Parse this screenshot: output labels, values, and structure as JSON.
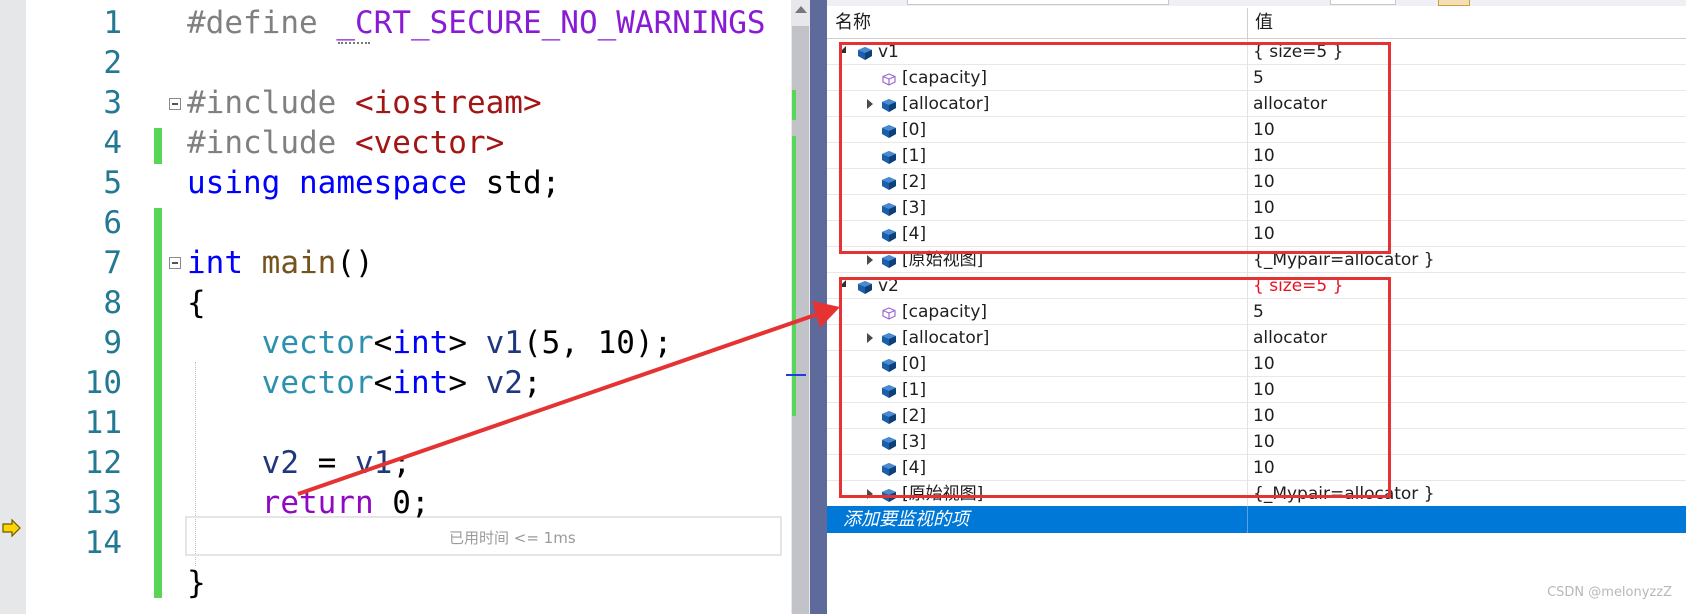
{
  "editor": {
    "line_numbers": [
      "1",
      "2",
      "3",
      "4",
      "5",
      "6",
      "7",
      "8",
      "9",
      "10",
      "11",
      "12",
      "13",
      "14"
    ],
    "code": {
      "l1_directive": "#define",
      "l1_macro": "_CRT_SECURE_NO_WARNINGS",
      "l3_directive": "#include",
      "l3_header": "<iostream>",
      "l4_directive": "#include",
      "l4_header": "<vector>",
      "l5_using": "using",
      "l5_namespace": "namespace",
      "l5_std": "std;",
      "l7_int": "int",
      "l7_main": "main",
      "l7_parens": "()",
      "l8_brace": "{",
      "l9_type": "vector",
      "l9_lt": "<",
      "l9_int": "int",
      "l9_rest": "> ",
      "l9_var": "v1",
      "l9_args": "(5, 10);",
      "l10_type": "vector",
      "l10_lt": "<",
      "l10_int": "int",
      "l10_rest": "> ",
      "l10_var": "v2",
      "l10_end": ";",
      "l12_lhs": "v2",
      "l12_op": " = ",
      "l12_rhs": "v1",
      "l12_end": ";",
      "l13_return": "return",
      "l13_rest": " 0;",
      "l14_brace": "}"
    },
    "perf_tip": "已用时间 <= 1ms"
  },
  "watch": {
    "columns": {
      "name": "名称",
      "value": "值"
    },
    "rows": [
      {
        "name": "v1",
        "value": "{ size=5 }"
      },
      {
        "name": "[capacity]",
        "value": "5"
      },
      {
        "name": "[allocator]",
        "value": "allocator"
      },
      {
        "name": "[0]",
        "value": "10"
      },
      {
        "name": "[1]",
        "value": "10"
      },
      {
        "name": "[2]",
        "value": "10"
      },
      {
        "name": "[3]",
        "value": "10"
      },
      {
        "name": "[4]",
        "value": "10"
      },
      {
        "name": "[原始视图]",
        "value": "{_Mypair=allocator }"
      },
      {
        "name": "v2",
        "value": "{ size=5 }"
      },
      {
        "name": "[capacity]",
        "value": "5"
      },
      {
        "name": "[allocator]",
        "value": "allocator"
      },
      {
        "name": "[0]",
        "value": "10"
      },
      {
        "name": "[1]",
        "value": "10"
      },
      {
        "name": "[2]",
        "value": "10"
      },
      {
        "name": "[3]",
        "value": "10"
      },
      {
        "name": "[4]",
        "value": "10"
      },
      {
        "name": "[原始视图]",
        "value": "{_Mypair=allocator }"
      }
    ],
    "add_item_label": "添加要监视的项"
  },
  "watermark": "CSDN @melonyzzZ",
  "colors": {
    "annotation_red": "#e53333",
    "selection_blue": "#0078d7",
    "changed_value_red": "#e81123",
    "change_bar_green": "#57d657"
  },
  "icons": {
    "instruction_pointer": "yellow-arrow-icon",
    "field": "blue-cube-icon",
    "property": "purple-cube-icon"
  }
}
